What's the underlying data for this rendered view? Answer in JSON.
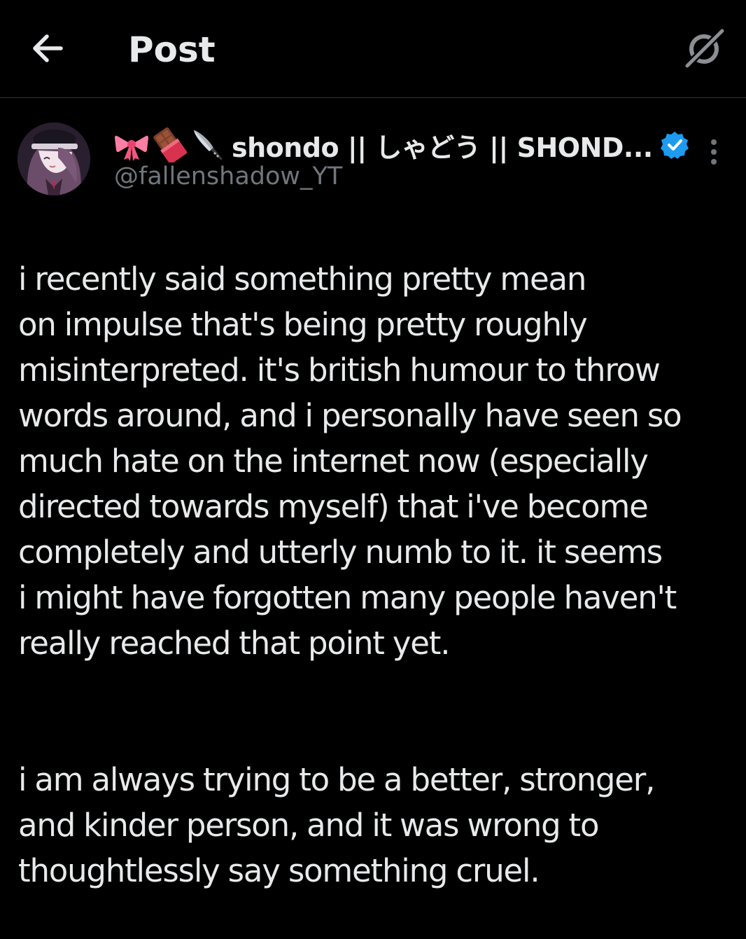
{
  "header": {
    "title": "Post"
  },
  "author": {
    "emojis": [
      "ribbon",
      "chocolate-bar",
      "kitchen-knife"
    ],
    "display_name": "shondo || しゃどう || SHOND...",
    "handle": "@fallenshadow_YT",
    "verified": true
  },
  "post": {
    "paragraphs": [
      "i recently said something pretty mean\non impulse that's being pretty roughly\nmisinterpreted. it's british humour to throw\nwords around, and i personally have seen so\nmuch hate on the internet now (especially\ndirected towards myself) that i've become\ncompletely and utterly numb to it. it seems\ni might have forgotten many people haven't\nreally reached that point yet.",
      "i am always trying to be a better, stronger,\nand kinder person, and it was wrong to\nthoughtlessly say something cruel."
    ]
  },
  "colors": {
    "background": "#000000",
    "text": "#e7e9ea",
    "secondary_text": "#71767b",
    "divider": "#2f3336",
    "verified_badge": "#1d9bf0"
  }
}
